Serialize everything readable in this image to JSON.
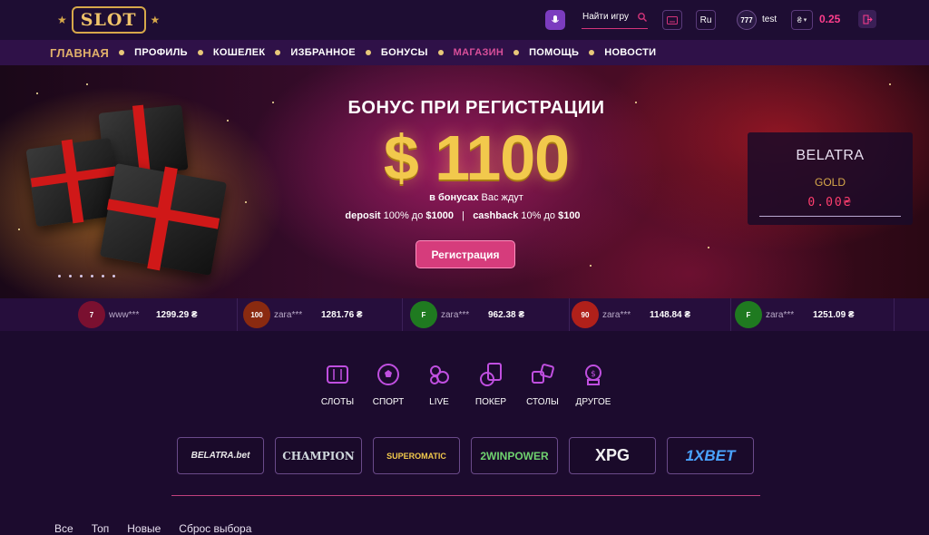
{
  "header": {
    "logo_text": "SLOT",
    "search_label": "Найти игру",
    "lang": "Ru",
    "avatar_text": "777",
    "username": "test",
    "currency_symbol": "₴",
    "balance": "0.25"
  },
  "nav": {
    "items": [
      {
        "label": "ГЛАВНАЯ"
      },
      {
        "label": "ПРОФИЛЬ"
      },
      {
        "label": "КОШЕЛЕК"
      },
      {
        "label": "ИЗБРАННОЕ"
      },
      {
        "label": "БОНУСЫ"
      },
      {
        "label": "МАГАЗИН"
      },
      {
        "label": "ПОМОЩЬ"
      },
      {
        "label": "НОВОСТИ"
      }
    ]
  },
  "hero": {
    "title": "БОНУС ПРИ РЕГИСТРАЦИИ",
    "amount": "$ 1100",
    "line1_bold": "в бонусах",
    "line1_rest": " Вас ждут",
    "deposit_label": "deposit",
    "deposit_text": " 100% до ",
    "deposit_value": "$1000",
    "separator": "|",
    "cashback_label": "cashback",
    "cashback_text": " 10% до ",
    "cashback_value": "$100",
    "register_button": "Регистрация"
  },
  "jackpot": {
    "provider": "BELATRA",
    "level": "GOLD",
    "value": "0.00₴"
  },
  "winners": [
    {
      "user": "www***",
      "amount": "1299.29 ₴",
      "color": "#7a1030",
      "tag": "7"
    },
    {
      "user": "zara***",
      "amount": "1281.76 ₴",
      "color": "#8a2a10",
      "tag": "100"
    },
    {
      "user": "zara***",
      "amount": "962.38 ₴",
      "color": "#1f7a20",
      "tag": "F"
    },
    {
      "user": "zara***",
      "amount": "1148.84 ₴",
      "color": "#b0201a",
      "tag": "90"
    },
    {
      "user": "zara***",
      "amount": "1251.09 ₴",
      "color": "#1f7a20",
      "tag": "F"
    }
  ],
  "categories": [
    {
      "label": "СЛОТЫ",
      "icon": "slots-icon"
    },
    {
      "label": "СПОРТ",
      "icon": "soccer-ball-icon"
    },
    {
      "label": "LIVE",
      "icon": "live-chips-icon"
    },
    {
      "label": "ПОКЕР",
      "icon": "poker-cards-icon"
    },
    {
      "label": "СТОЛЫ",
      "icon": "dice-icon"
    },
    {
      "label": "ДРУГОЕ",
      "icon": "other-games-icon"
    }
  ],
  "providers": [
    {
      "label": "BELATRA.bet",
      "color": "#e8e8e8"
    },
    {
      "label": "CHAMPION",
      "color": "#cfd8dc"
    },
    {
      "label": "SUPEROMATIC",
      "color": "#f2c94c"
    },
    {
      "label": "2WINPOWER",
      "color": "#6fd26f"
    },
    {
      "label": "XPG",
      "color": "#f0f0f0"
    },
    {
      "label": "1XBET",
      "color": "#4aa3ff"
    }
  ],
  "filters": [
    "Все",
    "Топ",
    "Новые",
    "Сброс выбора"
  ],
  "colors": {
    "accent_pink": "#d63c7c",
    "gold": "#f2c94c",
    "bg": "#1c0b2e"
  }
}
